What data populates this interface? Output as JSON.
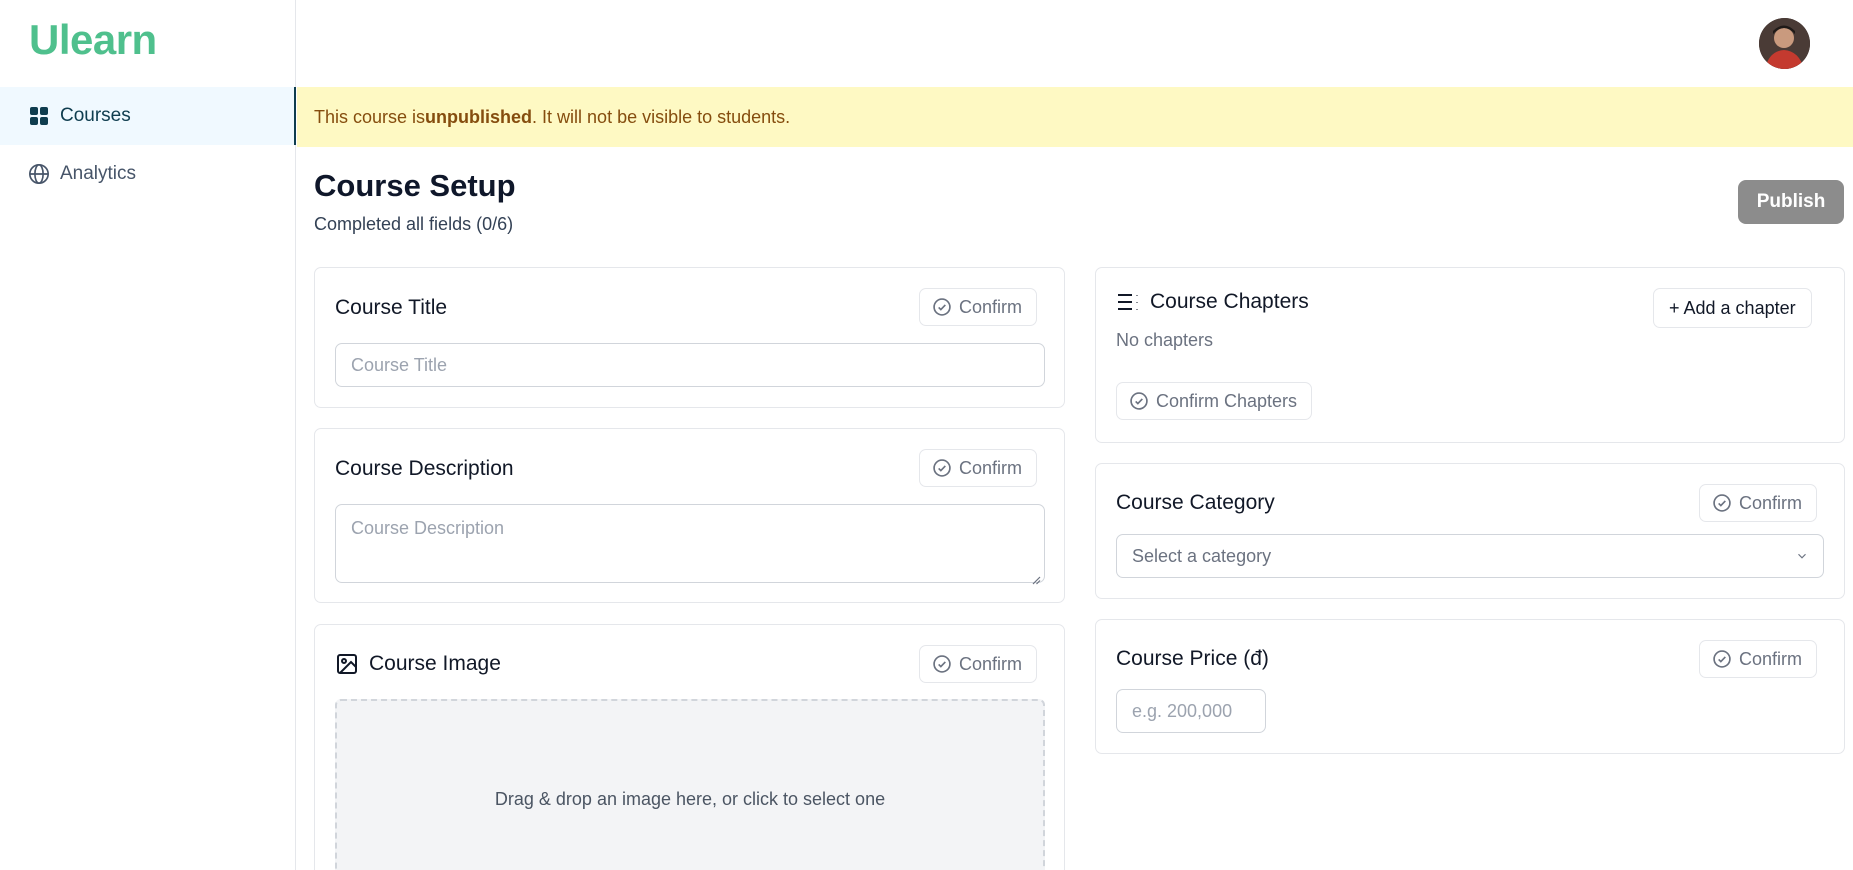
{
  "app": {
    "logo": "Ulearn"
  },
  "sidebar": {
    "items": [
      {
        "label": "Courses",
        "icon": "dashboard-grid-icon",
        "active": true
      },
      {
        "label": "Analytics",
        "icon": "globe-icon",
        "active": false
      }
    ]
  },
  "banner": {
    "prefix": "This course is ",
    "status": "unpublished",
    "suffix": ". It will not be visible to students."
  },
  "header": {
    "title": "Course Setup",
    "subtitle": "Completed all fields (0/6)",
    "publish_label": "Publish"
  },
  "confirm_label": "Confirm",
  "course_title": {
    "label": "Course Title",
    "placeholder": "Course Title",
    "value": ""
  },
  "course_description": {
    "label": "Course Description",
    "placeholder": "Course Description",
    "value": ""
  },
  "course_image": {
    "label": "Course Image",
    "dropzone_text": "Drag & drop an image here, or click to select one"
  },
  "course_chapters": {
    "label": "Course Chapters",
    "add_label": "+ Add a chapter",
    "empty_text": "No chapters",
    "confirm_label": "Confirm Chapters"
  },
  "course_category": {
    "label": "Course Category",
    "selected": "Select a category"
  },
  "course_price": {
    "label": "Course Price (đ)",
    "placeholder": "e.g. 200,000",
    "value": ""
  },
  "colors": {
    "brand": "#4fc08d",
    "banner_bg": "#fef9c3",
    "banner_text": "#854d0e",
    "publish_disabled": "#8c8c8c",
    "active_nav": "#0f3d4f"
  }
}
